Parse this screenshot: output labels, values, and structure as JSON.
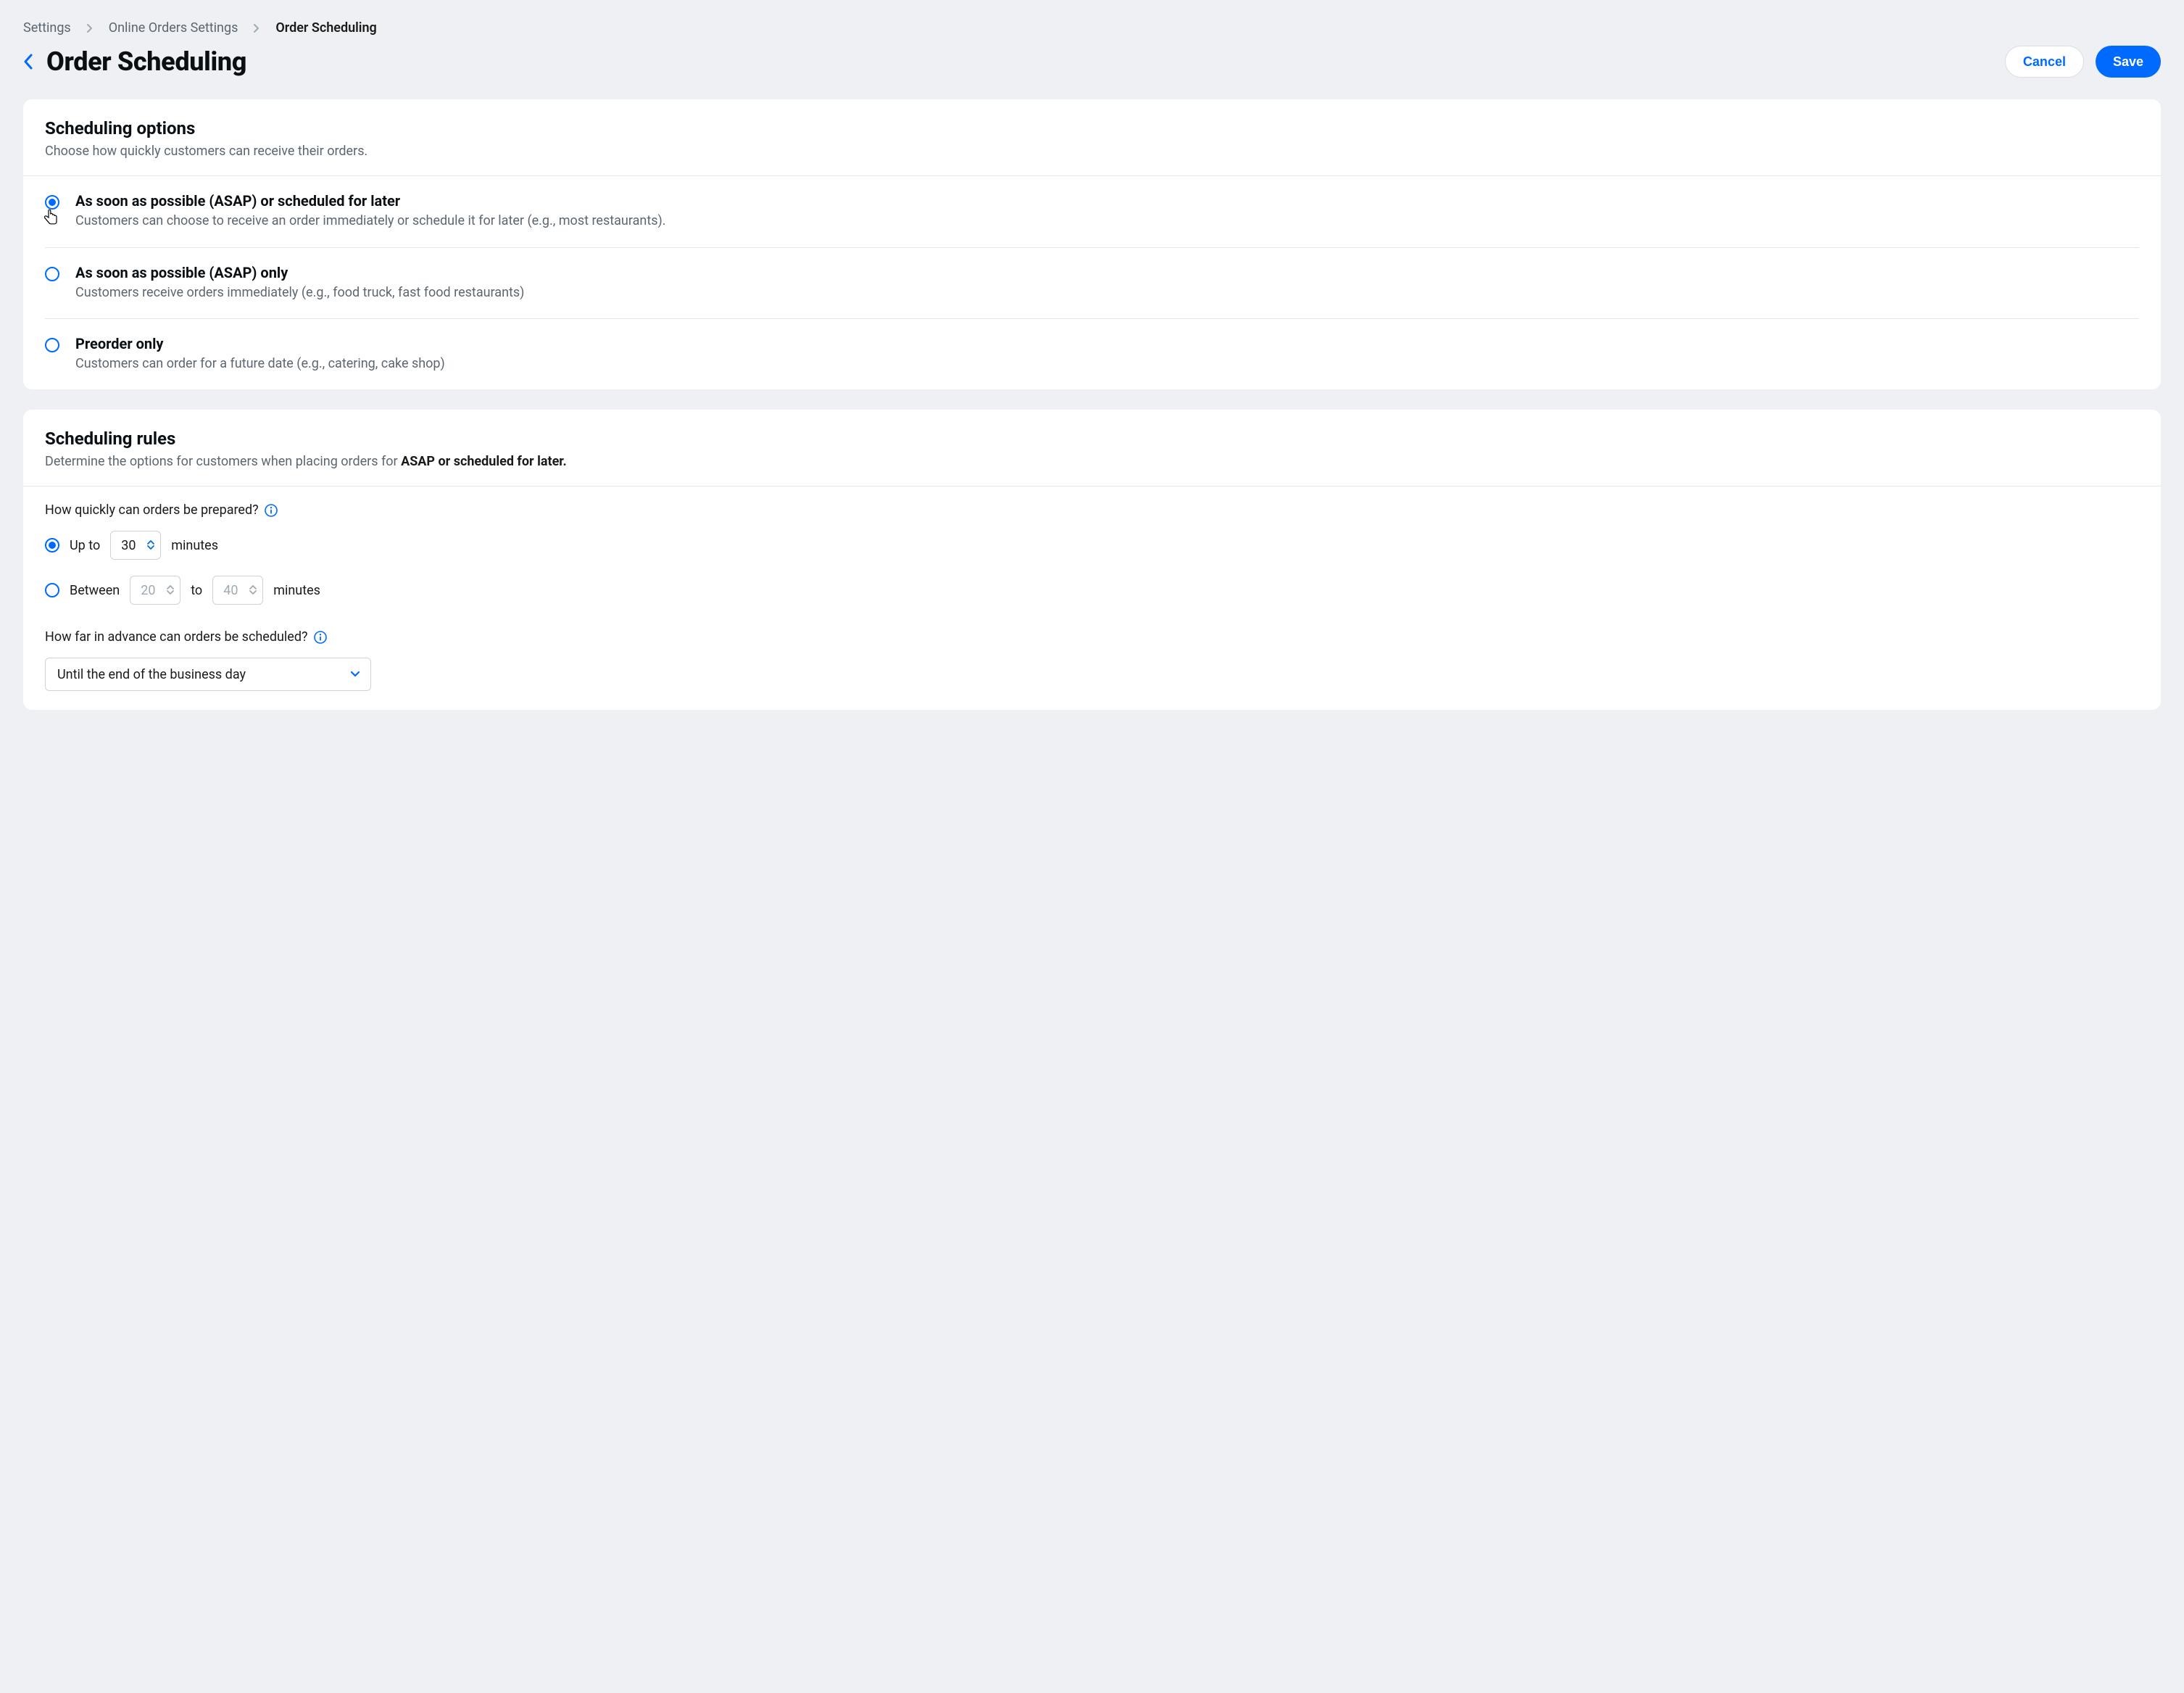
{
  "breadcrumbs": {
    "items": [
      "Settings",
      "Online Orders Settings",
      "Order Scheduling"
    ]
  },
  "header": {
    "title": "Order Scheduling",
    "cancel": "Cancel",
    "save": "Save"
  },
  "scheduling_options": {
    "title": "Scheduling options",
    "subtitle": "Choose how quickly customers can receive their orders.",
    "options": [
      {
        "title": "As soon as possible (ASAP) or scheduled for later",
        "desc": "Customers can choose to receive an order immediately or schedule it for later (e.g., most restaurants).",
        "selected": true
      },
      {
        "title": "As soon as possible (ASAP)  only",
        "desc": "Customers receive orders immediately (e.g., food truck, fast food restaurants)",
        "selected": false
      },
      {
        "title": "Preorder only",
        "desc": "Customers can order for a future date (e.g., catering, cake shop)",
        "selected": false
      }
    ]
  },
  "scheduling_rules": {
    "title": "Scheduling rules",
    "subtitle_prefix": "Determine the options for customers when placing orders for ",
    "subtitle_bold": "ASAP or scheduled for later.",
    "question1": "How quickly can orders be prepared?",
    "upto_label_pre": "Up to",
    "upto_value": "30",
    "upto_label_post": "minutes",
    "between_label_pre": "Between",
    "between_value_lo": "20",
    "between_to": "to",
    "between_value_hi": "40",
    "between_label_post": "minutes",
    "question2": "How far in advance can orders be scheduled?",
    "advance_select": "Until the end of the business day"
  }
}
